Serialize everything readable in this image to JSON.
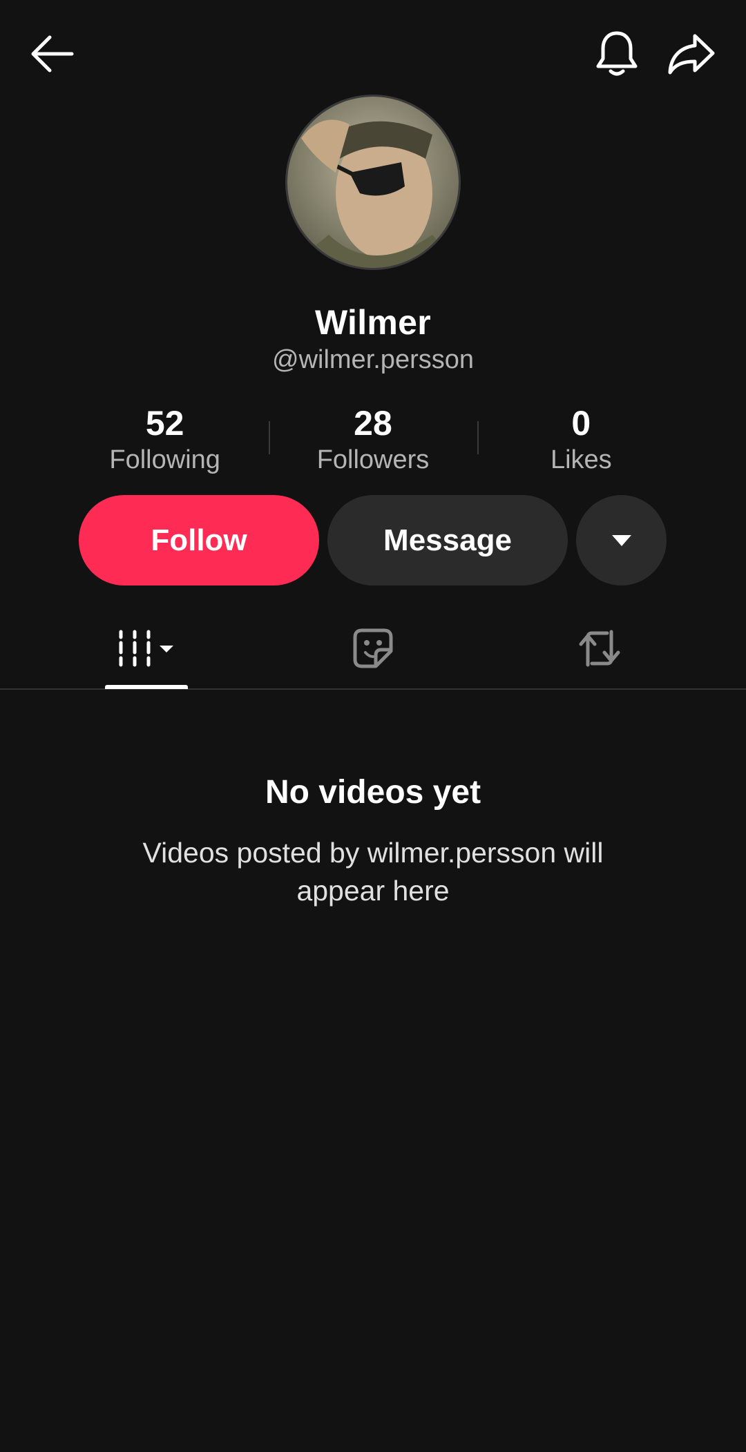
{
  "profile": {
    "display_name": "Wilmer",
    "username": "@wilmer.persson"
  },
  "stats": [
    {
      "value": "52",
      "label": "Following"
    },
    {
      "value": "28",
      "label": "Followers"
    },
    {
      "value": "0",
      "label": "Likes"
    }
  ],
  "actions": {
    "follow_label": "Follow",
    "message_label": "Message"
  },
  "tabs": [
    {
      "icon": "grid-icon",
      "active": true
    },
    {
      "icon": "sticker-icon",
      "active": false
    },
    {
      "icon": "repost-icon",
      "active": false
    }
  ],
  "empty_state": {
    "title": "No videos yet",
    "description": "Videos posted by wilmer.persson will appear here"
  },
  "colors": {
    "background": "#121212",
    "follow_accent": "#fe2c55",
    "secondary_button": "#2b2b2b",
    "muted_text": "#b5b5b5"
  }
}
